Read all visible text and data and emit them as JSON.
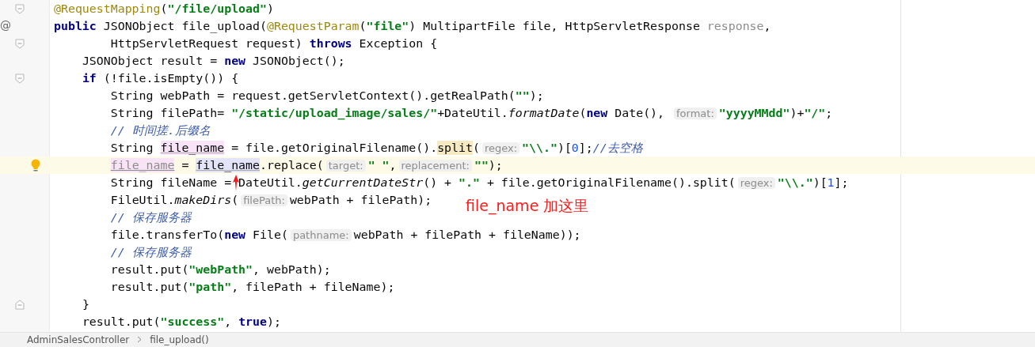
{
  "editor": {
    "lines": [
      {
        "gutter": {
          "kind": "fold"
        },
        "current": false,
        "tokens": [
          {
            "kind": "annotation",
            "text": "@RequestMapping"
          },
          {
            "kind": "plain",
            "text": "("
          },
          {
            "kind": "string",
            "text": "\"/file/upload\""
          },
          {
            "kind": "plain",
            "text": ")"
          }
        ]
      },
      {
        "gutter": {
          "kind": "at",
          "mark": "@"
        },
        "current": false,
        "tokens": [
          {
            "kind": "keyword",
            "text": "public"
          },
          {
            "kind": "plain",
            "text": " JSONObject file_upload("
          },
          {
            "kind": "annotation",
            "text": "@RequestParam"
          },
          {
            "kind": "plain",
            "text": "("
          },
          {
            "kind": "string",
            "text": "\"file\""
          },
          {
            "kind": "plain",
            "text": ") MultipartFile file, HttpServletResponse "
          },
          {
            "kind": "unused",
            "text": "response"
          },
          {
            "kind": "plain",
            "text": ","
          }
        ]
      },
      {
        "gutter": {
          "kind": "fold"
        },
        "current": false,
        "tokens": [
          {
            "kind": "plain",
            "text": "        HttpServletRequest request) "
          },
          {
            "kind": "keyword",
            "text": "throws"
          },
          {
            "kind": "plain",
            "text": " Exception {"
          }
        ]
      },
      {
        "current": false,
        "tokens": [
          {
            "kind": "plain",
            "text": "    JSONObject result = "
          },
          {
            "kind": "keyword",
            "text": "new"
          },
          {
            "kind": "plain",
            "text": " JSONObject();"
          }
        ]
      },
      {
        "gutter": {
          "kind": "fold"
        },
        "current": false,
        "tokens": [
          {
            "kind": "keyword",
            "text": "    if"
          },
          {
            "kind": "plain",
            "text": " (!file.isEmpty()) {"
          }
        ]
      },
      {
        "current": false,
        "tokens": [
          {
            "kind": "plain",
            "text": "        String webPath = request.getServletContext().getRealPath("
          },
          {
            "kind": "string",
            "text": "\"\""
          },
          {
            "kind": "plain",
            "text": ");"
          }
        ]
      },
      {
        "current": false,
        "tokens": [
          {
            "kind": "plain",
            "text": "        String filePath= "
          },
          {
            "kind": "string",
            "text": "\"/static/upload_image/sales/\""
          },
          {
            "kind": "plain",
            "text": "+DateUtil."
          },
          {
            "kind": "italic",
            "text": "formatDate"
          },
          {
            "kind": "plain",
            "text": "("
          },
          {
            "kind": "keyword",
            "text": "new"
          },
          {
            "kind": "plain",
            "text": " Date(), "
          },
          {
            "kind": "hint",
            "text": "format:"
          },
          {
            "kind": "string",
            "text": "\"yyyyMMdd\""
          },
          {
            "kind": "plain",
            "text": ")+"
          },
          {
            "kind": "string",
            "text": "\"/\""
          },
          {
            "kind": "plain",
            "text": ";"
          }
        ]
      },
      {
        "current": false,
        "tokens": [
          {
            "kind": "comment",
            "text": "        // 时间搓.后缀名"
          }
        ]
      },
      {
        "current": false,
        "tokens": [
          {
            "kind": "plain",
            "text": "        String "
          },
          {
            "kind": "declared",
            "text": "file_name"
          },
          {
            "kind": "plain",
            "text": " = file.getOriginalFilename()."
          },
          {
            "kind": "matched",
            "text": "split"
          },
          {
            "kind": "plain",
            "text": "("
          },
          {
            "kind": "hint",
            "text": "regex:"
          },
          {
            "kind": "string",
            "text": "\"\\\\.\""
          },
          {
            "kind": "plain",
            "text": ")["
          },
          {
            "kind": "number",
            "text": "0"
          },
          {
            "kind": "plain",
            "text": "];"
          },
          {
            "kind": "comment",
            "text": "//去空格"
          }
        ]
      },
      {
        "gutter": {
          "kind": "bulb"
        },
        "current": true,
        "tokens": [
          {
            "kind": "reassigned",
            "text": "        file_name"
          },
          {
            "kind": "plain",
            "text": " = "
          },
          {
            "kind": "reference",
            "text": "file_name"
          },
          {
            "kind": "plain",
            "text": ".replace("
          },
          {
            "kind": "hint",
            "text": "target:"
          },
          {
            "kind": "string",
            "text": "\" \""
          },
          {
            "kind": "plain",
            "text": ","
          },
          {
            "kind": "hint",
            "text": "replacement:"
          },
          {
            "kind": "string",
            "text": "\"\""
          },
          {
            "kind": "plain",
            "text": ");"
          }
        ]
      },
      {
        "current": false,
        "tokens": [
          {
            "kind": "plain",
            "text": "        String fileName ="
          },
          {
            "kind": "plain",
            "text": " DateUtil."
          },
          {
            "kind": "italic",
            "text": "getCurrentDateStr"
          },
          {
            "kind": "plain",
            "text": "() + "
          },
          {
            "kind": "string",
            "text": "\".\""
          },
          {
            "kind": "plain",
            "text": " + file.getOriginalFilename().split("
          },
          {
            "kind": "hint",
            "text": "regex:"
          },
          {
            "kind": "string",
            "text": "\"\\\\.\""
          },
          {
            "kind": "plain",
            "text": ")["
          },
          {
            "kind": "number",
            "text": "1"
          },
          {
            "kind": "plain",
            "text": "];"
          }
        ]
      },
      {
        "current": false,
        "tokens": [
          {
            "kind": "plain",
            "text": "        FileUtil."
          },
          {
            "kind": "italic",
            "text": "makeDirs"
          },
          {
            "kind": "plain",
            "text": "("
          },
          {
            "kind": "hint",
            "text": "filePath:"
          },
          {
            "kind": "plain",
            "text": "webPath + filePath);"
          }
        ]
      },
      {
        "current": false,
        "tokens": [
          {
            "kind": "comment",
            "text": "        // 保存服务器"
          }
        ]
      },
      {
        "current": false,
        "tokens": [
          {
            "kind": "plain",
            "text": "        file.transferTo("
          },
          {
            "kind": "keyword",
            "text": "new"
          },
          {
            "kind": "plain",
            "text": " File("
          },
          {
            "kind": "hint",
            "text": "pathname:"
          },
          {
            "kind": "plain",
            "text": "webPath + filePath + fileName));"
          }
        ]
      },
      {
        "current": false,
        "tokens": [
          {
            "kind": "comment",
            "text": "        // 保存服务器"
          }
        ]
      },
      {
        "current": false,
        "tokens": [
          {
            "kind": "plain",
            "text": "        result.put("
          },
          {
            "kind": "string",
            "text": "\"webPath\""
          },
          {
            "kind": "plain",
            "text": ", webPath);"
          }
        ]
      },
      {
        "current": false,
        "tokens": [
          {
            "kind": "plain",
            "text": "        result.put("
          },
          {
            "kind": "string",
            "text": "\"path\""
          },
          {
            "kind": "plain",
            "text": ", filePath + fileName);"
          }
        ]
      },
      {
        "gutter": {
          "kind": "fold-end"
        },
        "current": false,
        "tokens": [
          {
            "kind": "plain",
            "text": "    }"
          }
        ]
      },
      {
        "current": false,
        "tokens": [
          {
            "kind": "plain",
            "text": "    result.put("
          },
          {
            "kind": "string",
            "text": "\"success\""
          },
          {
            "kind": "plain",
            "text": ", "
          },
          {
            "kind": "keyword",
            "text": "true"
          },
          {
            "kind": "plain",
            "text": ");"
          }
        ]
      }
    ]
  },
  "annotation": {
    "label": "file_name 加这里"
  },
  "breadcrumb": [
    "AdminSalesController",
    "file_upload()"
  ]
}
